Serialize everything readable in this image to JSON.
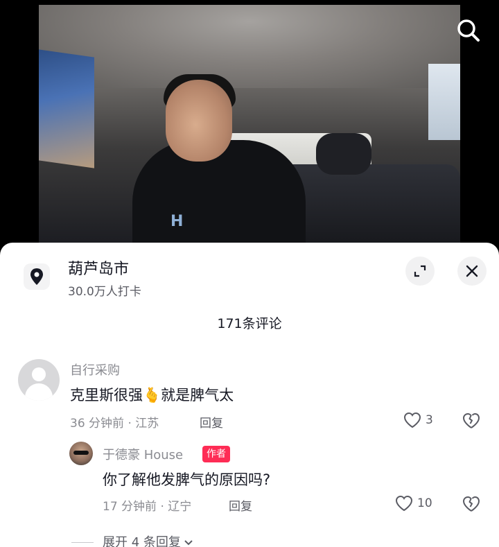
{
  "location": {
    "name": "葫芦岛市",
    "checkins": "30.0万人打卡"
  },
  "comments_header": {
    "title": "171条评论"
  },
  "comments": [
    {
      "user": "自行采购",
      "text_before": "克里斯很强",
      "emoji": "🫰",
      "text_after": "就是脾气太",
      "meta": "36 分钟前 · 江苏",
      "reply_label": "回复",
      "likes": "3"
    }
  ],
  "reply": {
    "user": "于德豪 House",
    "badge": "作者",
    "text": "你了解他发脾气的原因吗?",
    "meta": "17 分钟前 · 辽宁",
    "reply_label": "回复",
    "likes": "10"
  },
  "expand_replies": {
    "label": "展开 4 条回复"
  },
  "colors": {
    "accent": "#fe2c55",
    "text_primary": "#161823",
    "text_secondary": "#8a8b91",
    "sheet_bg": "#ffffff"
  },
  "icons": [
    "search-icon",
    "location-pin-icon",
    "expand-icon",
    "close-icon",
    "heart-icon",
    "broken-heart-icon",
    "chevron-down-icon"
  ]
}
